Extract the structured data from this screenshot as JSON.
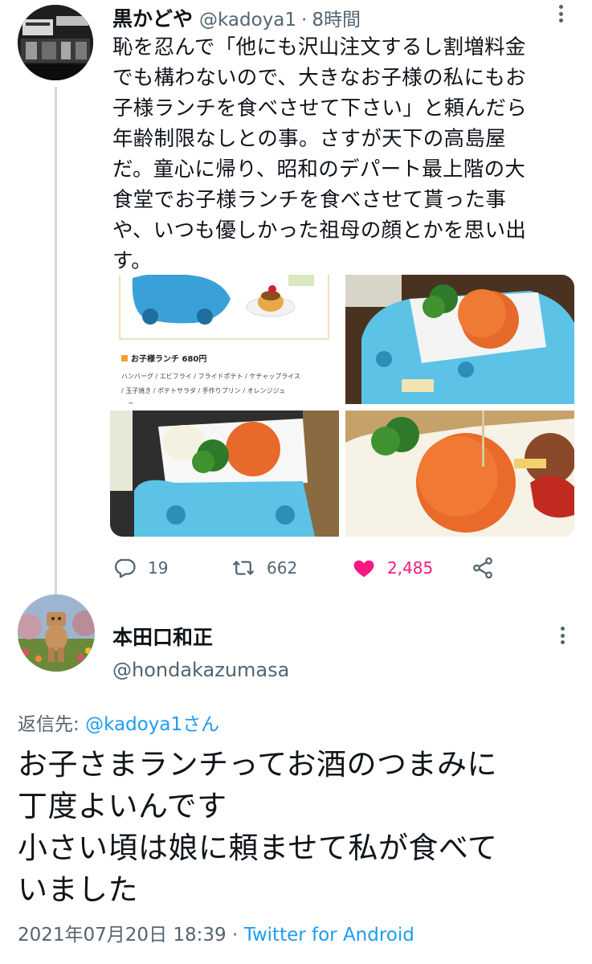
{
  "tweet1": {
    "name": "黒かどや",
    "handle": "@kadoya1",
    "separator": "·",
    "time": "8時間",
    "body_lines": [
      "恥を忍んで「他にも沢山注文するし割増料金",
      "でも構わないので、大きなお子様の私にもお",
      "子様ランチを食べさせて下さい」と頼んだら",
      "年齢制限なしとの事。さすが天下の高島屋",
      "だ。童心に帰り、昭和のデパート最上階の大",
      "食堂でお子様ランチを食べさせて貰った事",
      "や、いつも優しかった祖母の顔とかを思い出",
      "す。"
    ],
    "media": {
      "menu_title": "お子様ランチ 680円",
      "menu_items_line1": "ハンバーグ / エビフライ / フライドポテト / ケチャップライス",
      "menu_items_line2": "/ 玉子焼き / ポテトサラダ / 手作りプリン / オレンジジュ",
      "menu_items_line3": "ース"
    },
    "actions": {
      "replies": "19",
      "retweets": "662",
      "likes": "2,485"
    },
    "colors": {
      "like": "#f91880",
      "icon": "#536471"
    }
  },
  "tweet2": {
    "name": "本田口和正",
    "handle": "@hondakazumasa",
    "replying_label": "返信先: ",
    "replying_to": "@kadoya1さん",
    "body_lines": [
      "お子さまランチってお酒のつまみに",
      "丁度よいんです",
      "小さい頃は娘に頼ませて私が食べて",
      "いました"
    ],
    "date": "2021年07月20日 18:39",
    "separator": " · ",
    "source": "Twitter for Android"
  },
  "icons": {
    "more": "more-vertical-icon",
    "reply": "reply-icon",
    "retweet": "retweet-icon",
    "like": "heart-icon",
    "share": "share-icon"
  },
  "accent": "#1d9bf0"
}
